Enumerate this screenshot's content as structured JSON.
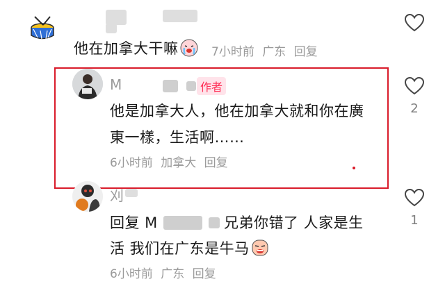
{
  "comments": [
    {
      "text": "他在加拿大干嘛",
      "time": "7小时前",
      "location": "广东",
      "reply": "回复",
      "likes": ""
    },
    {
      "name_initial": "M",
      "badge": "作者",
      "text_line1": "他是加拿大人，他在加拿大就和你在廣",
      "text_line2": "東一樣，生活啊……",
      "time": "6小时前",
      "location": "加拿大",
      "reply": "回复",
      "likes": "2"
    },
    {
      "name_initial": "刈",
      "reply_prefix": "回复 M",
      "text_after_mention": "兄弟你错了 人家是生",
      "text_line2": "活 我们在广东是牛马",
      "time": "6小时前",
      "location": "广东",
      "reply": "回复",
      "likes": "1"
    }
  ],
  "colors": {
    "highlight_border": "#d91b2a",
    "author_badge": "#ff2e55",
    "meta_text": "#9a9a9a"
  }
}
